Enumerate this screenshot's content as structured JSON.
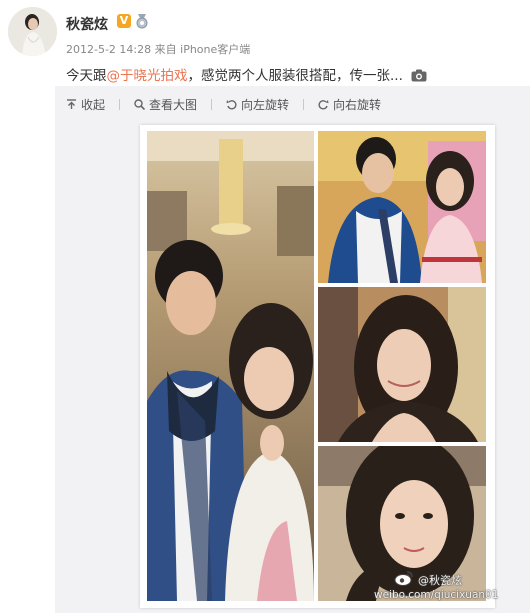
{
  "user": {
    "name": "秋瓷炫",
    "verified_label": "V"
  },
  "meta": {
    "datetime": "2012-5-2 14:28",
    "source": "来自 iPhone客户端"
  },
  "post": {
    "text_before": "今天跟",
    "mention": "@于晓光拍戏",
    "text_after": "，感觉两个人服装很搭配，传一张..."
  },
  "toolbar": [
    {
      "label": "收起",
      "icon": "collapse-icon"
    },
    {
      "label": "查看大图",
      "icon": "magnify-icon"
    },
    {
      "label": "向左旋转",
      "icon": "rotate-left-icon"
    },
    {
      "label": "向右旋转",
      "icon": "rotate-right-icon"
    }
  ],
  "watermark": {
    "handle": "@秋瓷炫",
    "url": "weibo.com/qiucixuan01"
  },
  "colors": {
    "mention": "#eb7350",
    "verified": "#f5a623",
    "panel": "#f2f2f5"
  }
}
